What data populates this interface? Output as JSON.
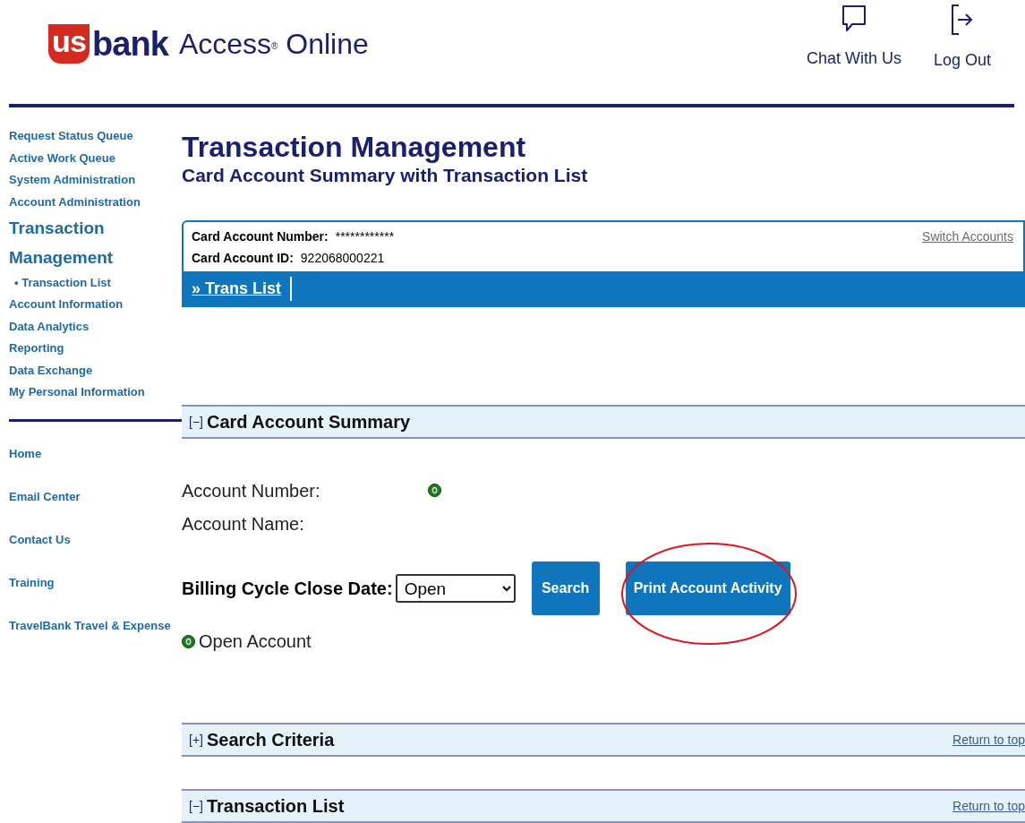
{
  "header": {
    "logo_mark": "us",
    "logo_word": "bank",
    "product": "Access",
    "product_mark": "®",
    "product_tail": "Online",
    "actions": [
      {
        "kind": "chat",
        "label": "Chat With Us"
      },
      {
        "kind": "logout",
        "label": "Log Out"
      }
    ]
  },
  "sidebar": {
    "items": [
      {
        "label": "Request Status Queue",
        "kind": "link"
      },
      {
        "label": "Active Work Queue",
        "kind": "link"
      },
      {
        "label": "System Administration",
        "kind": "link"
      },
      {
        "label": "Account Administration",
        "kind": "link"
      },
      {
        "label": "Transaction Management",
        "kind": "current"
      },
      {
        "label": "• Transaction List",
        "kind": "sub"
      },
      {
        "label": "Account Information",
        "kind": "link"
      },
      {
        "label": "Data Analytics",
        "kind": "link"
      },
      {
        "label": "Reporting",
        "kind": "link"
      },
      {
        "label": "Data Exchange",
        "kind": "link"
      },
      {
        "label": "My Personal Information",
        "kind": "link"
      }
    ],
    "footer_items": [
      "Home",
      "Email Center",
      "Contact Us",
      "Training",
      "TravelBank Travel & Expense"
    ]
  },
  "page": {
    "title": "Transaction Management",
    "subtitle": "Card Account Summary with Transaction List"
  },
  "account_box": {
    "number_label": "Card Account Number:",
    "number_value": "************",
    "id_label": "Card Account ID:",
    "id_value": "922068000221",
    "switch_link": "Switch Accounts",
    "tabs": [
      {
        "label": "» Trans List",
        "selected": true
      }
    ]
  },
  "sections": [
    {
      "toggle": "[−]",
      "title": "Card Account Summary"
    },
    {
      "toggle": "[+]",
      "title": "Search Criteria",
      "return_link": "Return to top"
    },
    {
      "toggle": "[−]",
      "title": "Transaction List",
      "return_link": "Return to top"
    }
  ],
  "summary": {
    "fields": [
      {
        "label": "Account Number:",
        "status_icon": true
      },
      {
        "label": "Account Name:",
        "status_icon": false
      }
    ],
    "billing_label": "Billing Cycle Close Date:",
    "billing_value": "Open",
    "search_button": "Search",
    "print_button": "Print Account Activity",
    "print_highlighted": true,
    "legend": "Open Account"
  }
}
